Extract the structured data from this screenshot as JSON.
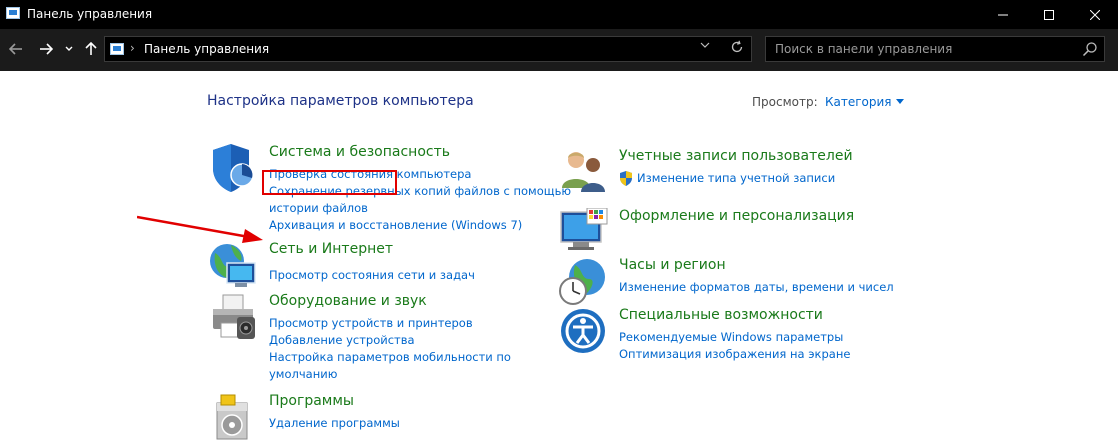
{
  "window": {
    "title": "Панель управления"
  },
  "address": {
    "path": "Панель управления",
    "separator": "›"
  },
  "search": {
    "placeholder": "Поиск в панели управления"
  },
  "page": {
    "title": "Настройка параметров компьютера",
    "view_label": "Просмотр:",
    "view_value": "Категория"
  },
  "left_categories": [
    {
      "title": "Система и безопасность",
      "icon": "shield-icon",
      "links": [
        "Проверка состояния компьютера",
        "Сохранение резервных копий файлов с помощью",
        "истории файлов",
        "Архивация и восстановление (Windows 7)"
      ]
    },
    {
      "title": "Сеть и Интернет",
      "icon": "network-globe-icon",
      "links": [
        "Просмотр состояния сети и задач"
      ]
    },
    {
      "title": "Оборудование и звук",
      "icon": "printer-icon",
      "links": [
        "Просмотр устройств и принтеров",
        "Добавление устройства",
        "Настройка параметров мобильности по",
        "умолчанию"
      ]
    },
    {
      "title": "Программы",
      "icon": "programs-icon",
      "links": [
        "Удаление программы"
      ]
    }
  ],
  "right_categories": [
    {
      "title": "Учетные записи пользователей",
      "icon": "users-icon",
      "links": [
        "Изменение типа учетной записи"
      ]
    },
    {
      "title": "Оформление и персонализация",
      "icon": "monitor-palette-icon",
      "links": []
    },
    {
      "title": "Часы и регион",
      "icon": "clock-globe-icon",
      "links": [
        "Изменение форматов даты, времени и чисел"
      ]
    },
    {
      "title": "Специальные возможности",
      "icon": "accessibility-icon",
      "links": [
        "Рекомендуемые Windows параметры",
        "Оптимизация изображения на экране"
      ]
    }
  ],
  "colors": {
    "category_green": "#1a7a1a",
    "link_blue": "#0066cc",
    "title_blue": "#1e3287",
    "highlight_red": "#e10000"
  }
}
